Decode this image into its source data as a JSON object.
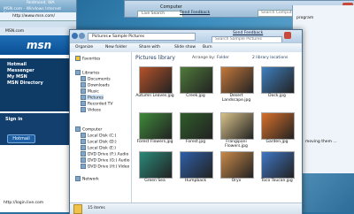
{
  "ie": {
    "window_title": "MSN.com - Windows Internet Explorer",
    "address": "http://www.msn.com/",
    "tab": "MSN.com",
    "msn_logo": "msn",
    "nav_links": [
      "Hotmail",
      "Messenger",
      "My MSN",
      "MSN Directory"
    ],
    "sign_in": "Sign in",
    "hotmail_button": "Hotmail",
    "status_url": "http://login.live.com"
  },
  "background_window": {
    "title": "Computer",
    "search_placeholder": "Live Search",
    "send_feedback": "Send Feedback",
    "search_computer": "Search Computer",
    "program_text": "program",
    "moving_text": "moving them ...",
    "location_text": "Redmond, WA"
  },
  "explorer": {
    "breadcrumb": [
      "Pictures",
      "Sample Pictures"
    ],
    "send_feedback": "Send Feedback",
    "search_placeholder": "Search Sample Pictures",
    "commands": [
      "Organize",
      "New folder",
      "Share with",
      "Slide show",
      "Burn"
    ],
    "library_title": "Pictures library",
    "arrange_by": "Arrange by:",
    "arrange_value": "Folder",
    "library_locations": "2 library locations",
    "status": "15 items",
    "nav": {
      "favorites": "Favorites",
      "libraries": "Libraries",
      "library_items": [
        "Documents",
        "Downloads",
        "Music",
        "Pictures",
        "Recorded TV",
        "Videos"
      ],
      "computer": "Computer",
      "drives": [
        "Local Disk (C:)",
        "Local Disk (D:)",
        "Local Disk (E:)",
        "DVD Drive (F:) Audio",
        "DVD Drive (G:) Audio",
        "DVD Drive (H:) Video"
      ],
      "network": "Network"
    },
    "files": [
      {
        "name": "Autumn Leaves.jpg",
        "color": "#b5532a"
      },
      {
        "name": "Creek.jpg",
        "color": "#4f7a3a"
      },
      {
        "name": "Desert Landscape.jpg",
        "color": "#c4793c"
      },
      {
        "name": "Dock.jpg",
        "color": "#3f7fbf"
      },
      {
        "name": "Forest Flowers.jpg",
        "color": "#3f8a3a"
      },
      {
        "name": "Forest.jpg",
        "color": "#2f5c2a"
      },
      {
        "name": "Frangipani Flowers.jpg",
        "color": "#d8c28a"
      },
      {
        "name": "Garden.jpg",
        "color": "#d8702a"
      },
      {
        "name": "Green Sea",
        "color": "#2a8a7a"
      },
      {
        "name": "Humpback",
        "color": "#2f5fa8"
      },
      {
        "name": "Oryx",
        "color": "#c98a4a"
      },
      {
        "name": "Toco Toucan.jpg",
        "color": "#3f76c4"
      }
    ]
  }
}
